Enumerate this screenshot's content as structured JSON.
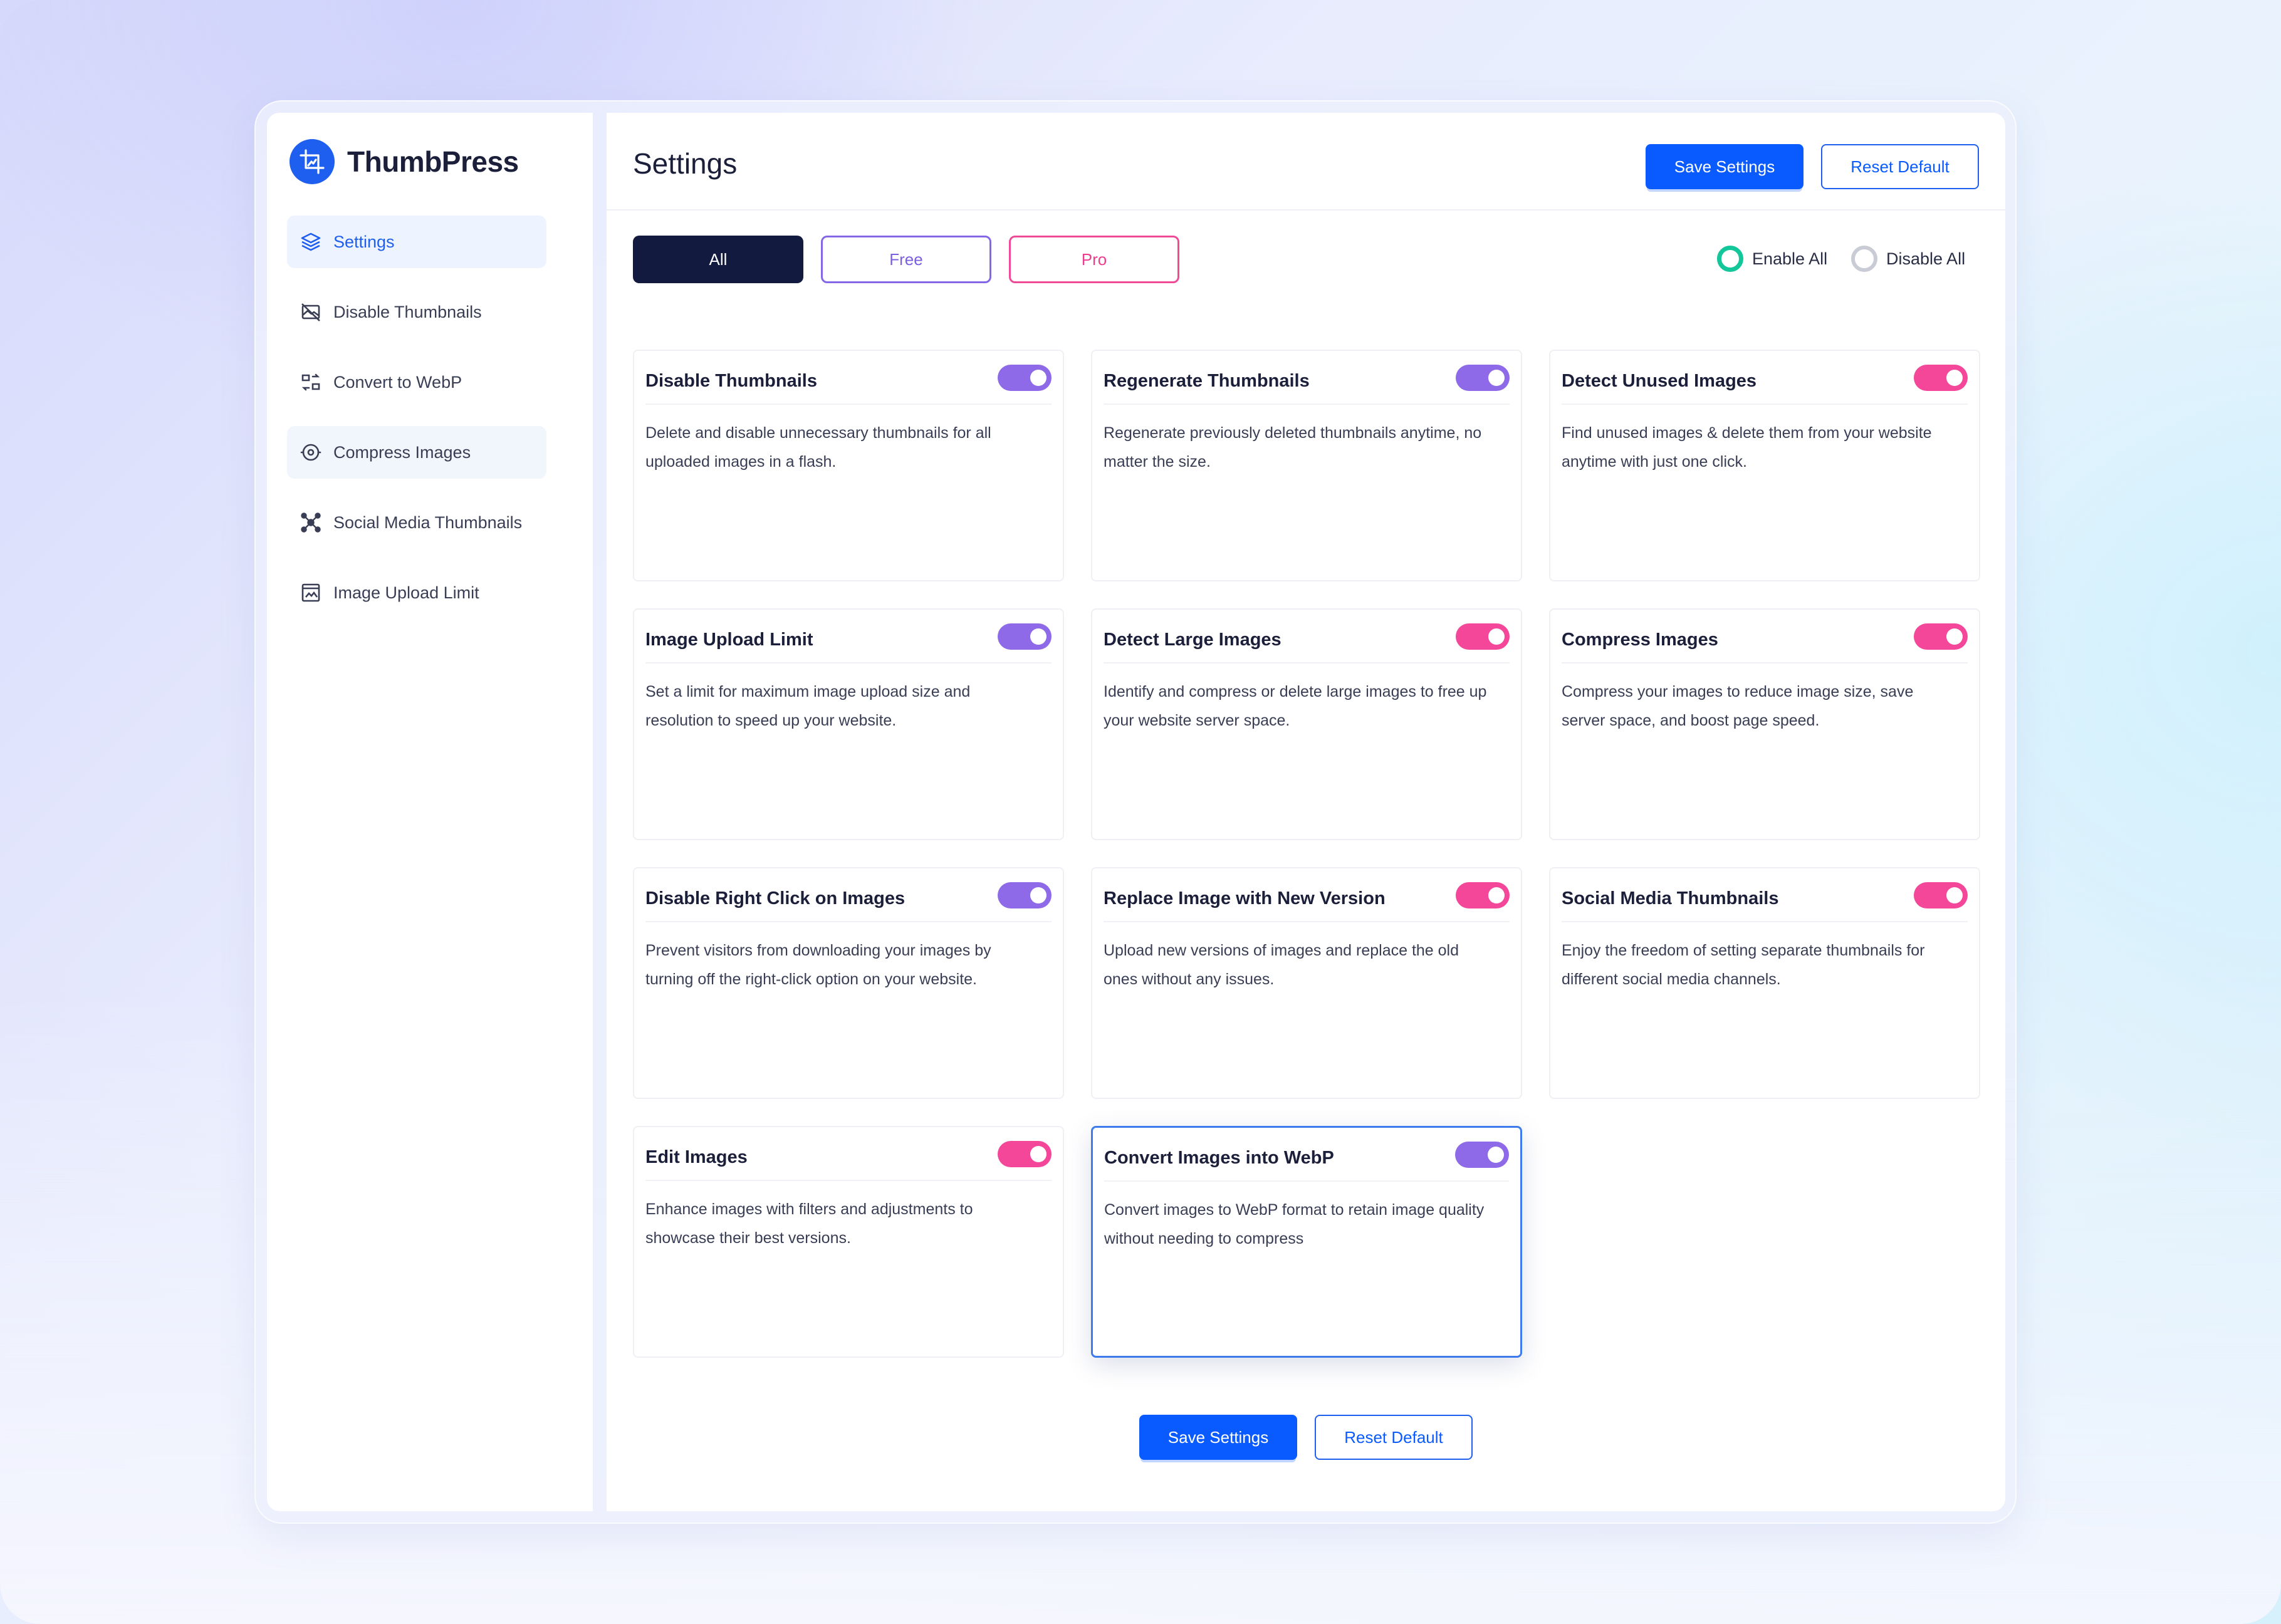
{
  "app": {
    "name": "ThumbPress"
  },
  "colors": {
    "primary": "#0a5bff",
    "free_accent": "#8e6ae8",
    "pro_accent": "#f4479a",
    "enable": "#13c79a",
    "dark": "#121a3f"
  },
  "sidebar": {
    "items": [
      {
        "label": "Settings",
        "icon": "layers-icon",
        "active": true
      },
      {
        "label": "Disable Thumbnails",
        "icon": "image-slash-icon"
      },
      {
        "label": "Convert to WebP",
        "icon": "convert-icon"
      },
      {
        "label": "Compress Images",
        "icon": "compress-icon"
      },
      {
        "label": "Social Media Thumbnails",
        "icon": "network-icon"
      },
      {
        "label": "Image Upload Limit",
        "icon": "upload-limit-icon"
      }
    ]
  },
  "header": {
    "title": "Settings",
    "save_label": "Save Settings",
    "reset_label": "Reset Default"
  },
  "filters": {
    "all": "All",
    "free": "Free",
    "pro": "Pro",
    "selected": "All"
  },
  "bulk": {
    "enable_all": "Enable All",
    "disable_all": "Disable All",
    "selected": "Enable All"
  },
  "modules": [
    {
      "title": "Disable Thumbnails",
      "desc": "Delete and disable unnecessary thumbnails for all uploaded images in a flash.",
      "tier": "free",
      "enabled": true
    },
    {
      "title": "Regenerate Thumbnails",
      "desc": "Regenerate previously deleted thumbnails anytime, no matter the size.",
      "tier": "free",
      "enabled": true
    },
    {
      "title": "Detect Unused Images",
      "desc": "Find unused images & delete them from your website anytime with just one click.",
      "tier": "pro",
      "enabled": true
    },
    {
      "title": "Image Upload Limit",
      "desc": "Set a limit for maximum image upload size and resolution to speed up your website.",
      "tier": "free",
      "enabled": true
    },
    {
      "title": "Detect Large Images",
      "desc": "Identify and compress or delete large images to free up your website server space.",
      "tier": "pro",
      "enabled": true
    },
    {
      "title": "Compress Images",
      "desc": "Compress your images to reduce image size, save server space, and boost page speed.",
      "tier": "pro",
      "enabled": true
    },
    {
      "title": "Disable Right Click on Images",
      "desc": "Prevent visitors from downloading your images by turning off the right-click option on your website.",
      "tier": "free",
      "enabled": true
    },
    {
      "title": "Replace Image with New Version",
      "desc": "Upload new versions of images and replace the old ones without any issues.",
      "tier": "pro",
      "enabled": true
    },
    {
      "title": "Social Media Thumbnails",
      "desc": "Enjoy the freedom of setting separate thumbnails for different social media channels.",
      "tier": "pro",
      "enabled": true
    },
    {
      "title": "Edit Images",
      "desc": "Enhance images with filters and adjustments to showcase their best versions.",
      "tier": "pro",
      "enabled": true
    },
    {
      "title": "Convert Images into WebP",
      "desc": "Convert images to WebP format to retain image quality without needing to compress",
      "tier": "free",
      "enabled": true
    }
  ],
  "footer": {
    "save_label": "Save Settings",
    "reset_label": "Reset Default"
  }
}
